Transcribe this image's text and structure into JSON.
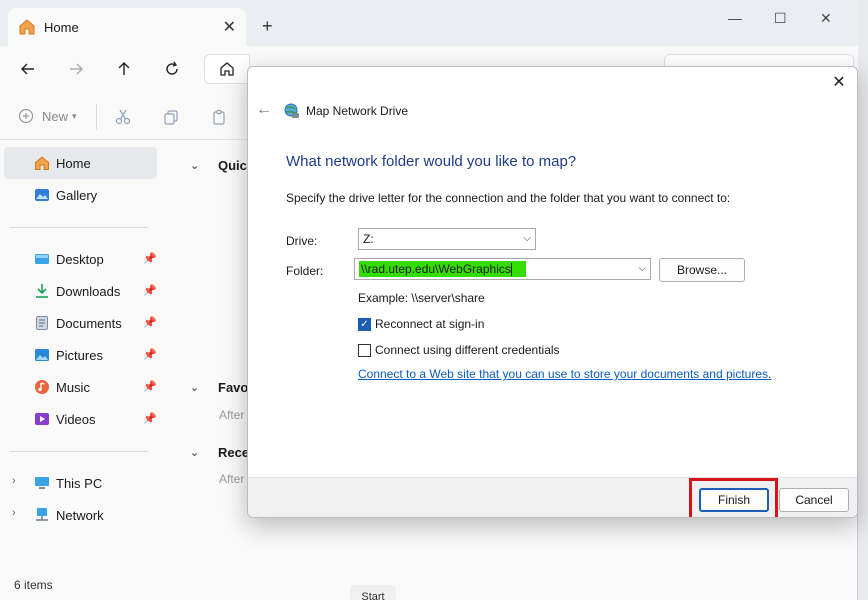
{
  "explorer": {
    "tab_label": "Home",
    "tab_close": "✕",
    "new_tab": "+",
    "window_controls": {
      "minimize": "—",
      "maximize": "☐",
      "close": "✕"
    },
    "toolbar": {
      "new_label": "New",
      "new_caret": "▾"
    },
    "sidebar": {
      "items": [
        {
          "label": "Home"
        },
        {
          "label": "Gallery"
        },
        {
          "label": "Desktop"
        },
        {
          "label": "Downloads"
        },
        {
          "label": "Documents"
        },
        {
          "label": "Pictures"
        },
        {
          "label": "Music"
        },
        {
          "label": "Videos"
        },
        {
          "label": "This PC"
        },
        {
          "label": "Network"
        }
      ]
    },
    "sections": [
      {
        "title": "Quick"
      },
      {
        "title": "Favor",
        "subtitle": "After"
      },
      {
        "title": "Recen",
        "subtitle": "After"
      }
    ],
    "status": "6 items",
    "taskbar_peek": "Start"
  },
  "dialog": {
    "close": "✕",
    "back": "←",
    "title": "Map Network Drive",
    "heading": "What network folder would you like to map?",
    "description": "Specify the drive letter for the connection and the folder that you want to connect to:",
    "drive_label": "Drive:",
    "drive_value": "Z:",
    "folder_label": "Folder:",
    "folder_value": "\\\\rad.utep.edu\\WebGraphics",
    "browse_label": "Browse...",
    "example": "Example: \\\\server\\share",
    "reconnect_label": "Reconnect at sign-in",
    "reconnect_checked": true,
    "credentials_label": "Connect using different credentials",
    "credentials_checked": false,
    "link": "Connect to a Web site that you can use to store your documents and pictures",
    "link_suffix": ".",
    "finish_label": "Finish",
    "cancel_label": "Cancel"
  },
  "colors": {
    "heading": "#1f3c88",
    "link": "#0b5cbf",
    "highlight": "#33dd00",
    "callout": "#d7141a",
    "checkbox": "#1b5fb5"
  }
}
